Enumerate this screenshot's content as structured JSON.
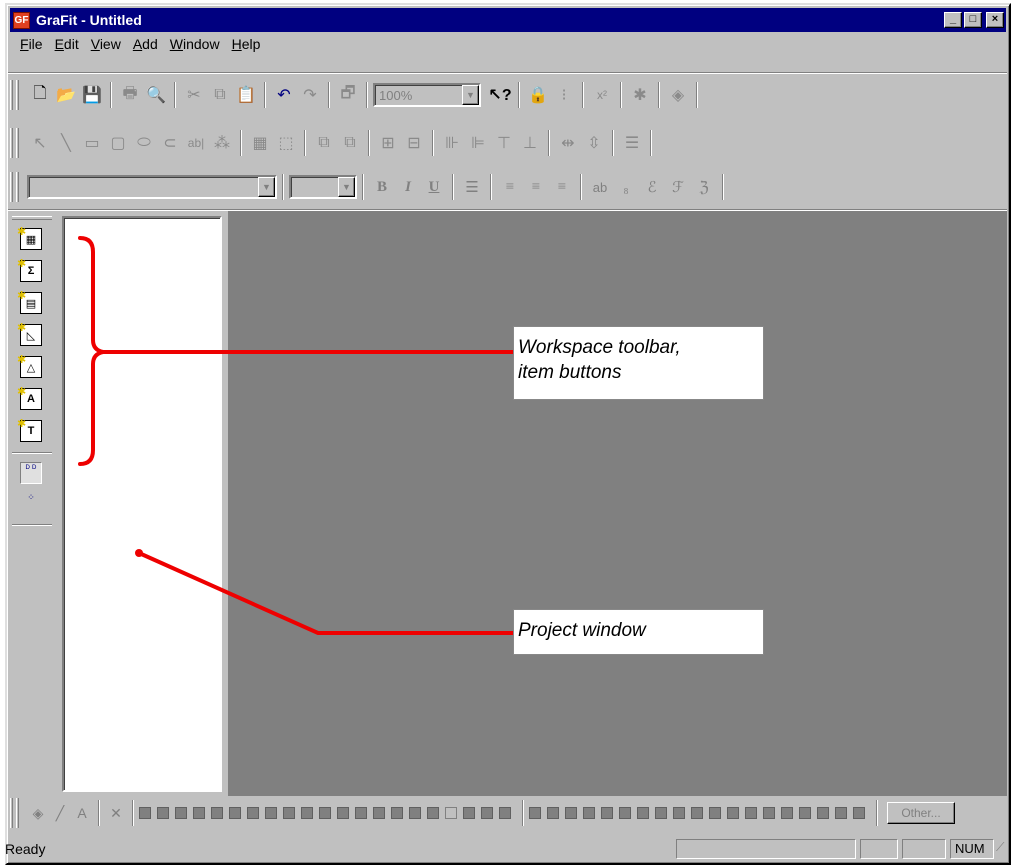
{
  "window": {
    "title": "GraFit - Untitled",
    "app_icon_glyph": "GF",
    "caption": {
      "minimize": "_",
      "maximize": "□",
      "close": "×"
    }
  },
  "menubar": {
    "items": [
      {
        "label": "File",
        "accel": "F",
        "rest": "ile"
      },
      {
        "label": "Edit",
        "accel": "E",
        "rest": "dit"
      },
      {
        "label": "View",
        "accel": "V",
        "rest": "iew"
      },
      {
        "label": "Add",
        "accel": "A",
        "rest": "dd"
      },
      {
        "label": "Window",
        "accel": "W",
        "rest": "indow"
      },
      {
        "label": "Help",
        "accel": "H",
        "rest": "elp"
      }
    ]
  },
  "standard_toolbar": {
    "zoom_value": "100%",
    "glyphs": {
      "new": "🗋",
      "open": "📂",
      "save": "💾",
      "print": "🖶",
      "preview": "🔍",
      "cut": "✂",
      "copy": "⧉",
      "paste": "📋",
      "undo": "↶",
      "redo": "↷",
      "properties": "🗗",
      "help": "↖?",
      "lock": "🔒",
      "format": "⁝",
      "subscript": "x²",
      "sparkle": "✱",
      "layers": "◈"
    }
  },
  "drawing_toolbar": {
    "glyphs": {
      "pointer": "↖",
      "line": "╲",
      "rectangle": "▭",
      "rounded_rect": "▢",
      "ellipse": "⬭",
      "polygon": "⊂",
      "text": "ab|",
      "magic": "⁂",
      "grid": "▦",
      "frame": "⬚",
      "bring_front": "⧉",
      "send_back": "⧉",
      "group": "⊞",
      "ungroup": "⊟",
      "align_l": "⊪",
      "align_r": "⊫",
      "align_t": "⊤",
      "align_b": "⊥",
      "dist_h": "⇹",
      "dist_v": "⇳",
      "list": "☰"
    }
  },
  "format_toolbar": {
    "font_name": "",
    "font_size": "",
    "glyphs": {
      "bold": "B",
      "italic": "I",
      "underline": "U",
      "bullets": "☰",
      "align_left": "≡",
      "align_center": "≡",
      "align_right": "≡",
      "ab": "ab",
      "sub": "₈",
      "sym1": "ℰ",
      "sym2": "ℱ",
      "sym3": "ℨ"
    }
  },
  "workspace_toolbar": {
    "item_buttons": [
      {
        "name": "data-table",
        "glyph": "▦"
      },
      {
        "name": "sigma",
        "glyph": "Σ"
      },
      {
        "name": "results",
        "glyph": "▤"
      },
      {
        "name": "graph",
        "glyph": "◺"
      },
      {
        "name": "fit",
        "glyph": "△"
      },
      {
        "name": "text",
        "glyph": "A"
      },
      {
        "name": "notes",
        "glyph": "T"
      }
    ],
    "view_buttons": [
      {
        "name": "view-details",
        "glyph": "ᴰ ᴰ"
      },
      {
        "name": "view-tree",
        "glyph": "⁘"
      }
    ]
  },
  "annotations": {
    "workspace": {
      "line1": "Workspace toolbar,",
      "line2": "item buttons"
    },
    "project": {
      "line1": "Project window"
    }
  },
  "palette": {
    "glyphs": {
      "fill": "◈",
      "pen": "╱",
      "text_color": "A",
      "none": "✕"
    },
    "swatch_count": 40,
    "empty_swatch_index": 17,
    "other_label": "Other..."
  },
  "statusbar": {
    "text": "Ready",
    "num_label": "NUM"
  },
  "colors": {
    "title_bar": "#000080",
    "mdi_background": "#808080",
    "face": "#c0c0c0",
    "annotation_red": "#ee0000"
  }
}
